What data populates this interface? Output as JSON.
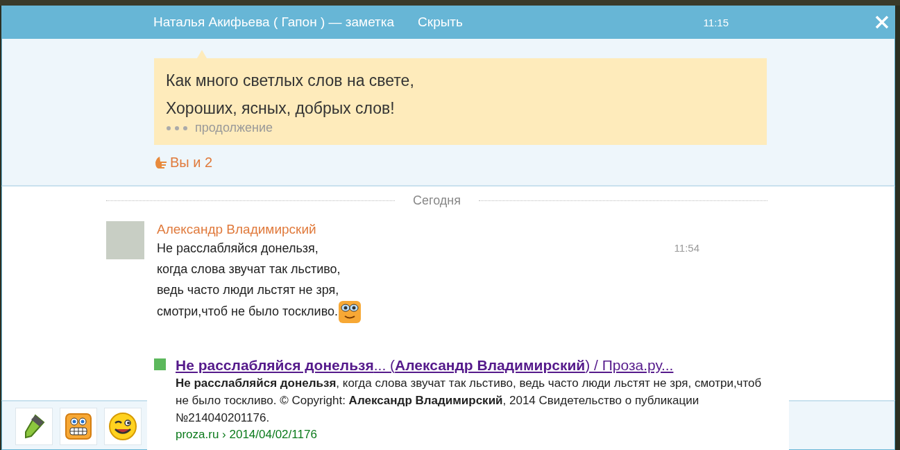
{
  "header": {
    "title": "Наталья Акифьева ( Гапон ) — заметка",
    "hide_link": "Скрыть",
    "time": "11:15"
  },
  "note": {
    "lines": [
      "Как много светлых слов на свете,",
      "Хороших, ясных, добрых слов!"
    ],
    "more": "продолжение",
    "likes": "Вы и 2"
  },
  "chat": {
    "day_divider": "Сегодня",
    "messages": [
      {
        "author": "Александр Владимирский",
        "lines": [
          "Не расслабляйся донельзя,",
          "когда слова звучат так льстиво,",
          "ведь часто люди льстят не зря,",
          "смотри,чтоб не было тоскливо."
        ],
        "time": "11:54"
      }
    ]
  },
  "toolbar": {
    "buttons": [
      {
        "kind": "marker"
      },
      {
        "kind": "grin"
      },
      {
        "kind": "wink"
      }
    ]
  },
  "preview": {
    "title": "**Не расслабляйся донельзя**... (**Александр Владимирский**) / Проза.ру...",
    "snippet": "**Не расслабляйся донельзя**, когда слова звучат так льстиво, ведь часто люди льстят не зря, смотри,чтоб не было тоскливо. © Copyright: **Александр Владимирский**, 2014 Свидетельство о публикации №214040201176.",
    "url": "proza.ru › 2014/04/02/1176"
  }
}
